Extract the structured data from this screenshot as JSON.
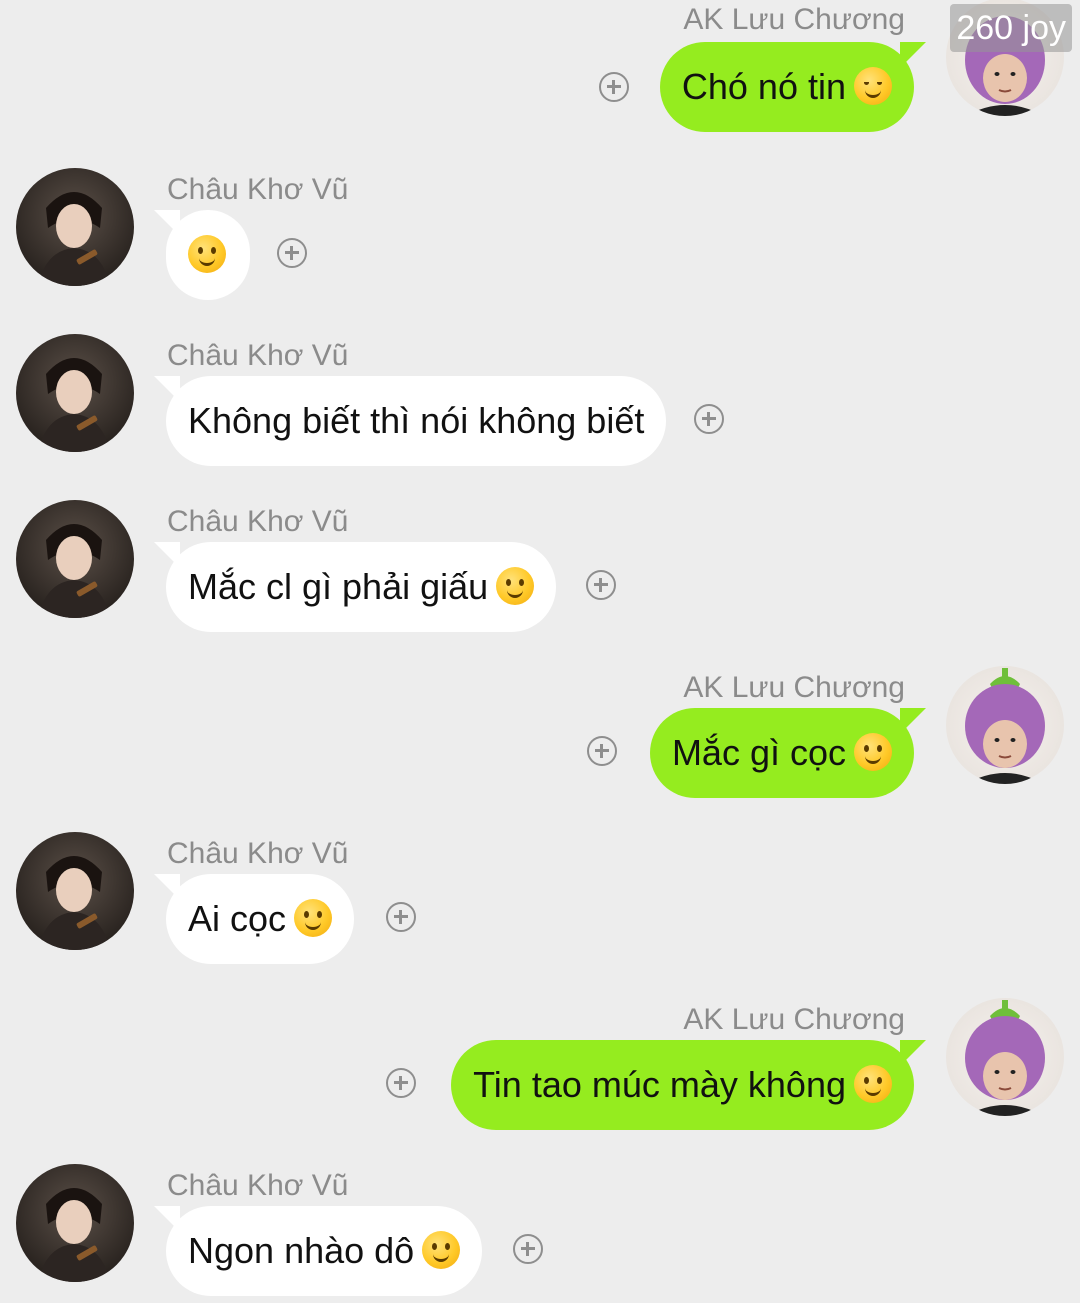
{
  "watermark": "260 joy",
  "users": {
    "other_name": "Châu Khơ Vũ",
    "self_name": "AK Lưu Chương"
  },
  "icons": {
    "add": "plus-circle-icon",
    "smile": "slightly-smiling-face-emoji",
    "relieved": "relieved-face-emoji"
  },
  "colors": {
    "background": "#ededed",
    "self_bubble": "#95ec1f",
    "other_bubble": "#ffffff",
    "name_text": "#8b8b8b"
  },
  "messages": [
    {
      "sender": "AK Lưu Chương",
      "text": "Chó nó tin",
      "emoji": "relieved"
    },
    {
      "sender": "Châu Khơ Vũ",
      "text": "",
      "emoji": "smile"
    },
    {
      "sender": "Châu Khơ Vũ",
      "text": "Không biết thì nói không biết",
      "emoji": ""
    },
    {
      "sender": "Châu Khơ Vũ",
      "text": "Mắc cl gì phải giấu",
      "emoji": "smile"
    },
    {
      "sender": "AK Lưu Chương",
      "text": "Mắc gì cọc",
      "emoji": "smile"
    },
    {
      "sender": "Châu Khơ Vũ",
      "text": "Ai cọc",
      "emoji": "smile"
    },
    {
      "sender": "AK Lưu Chương",
      "text": "Tin tao múc mày không",
      "emoji": "smile"
    },
    {
      "sender": "Châu Khơ Vũ",
      "text": "Ngon nhào dô",
      "emoji": "smile"
    }
  ]
}
